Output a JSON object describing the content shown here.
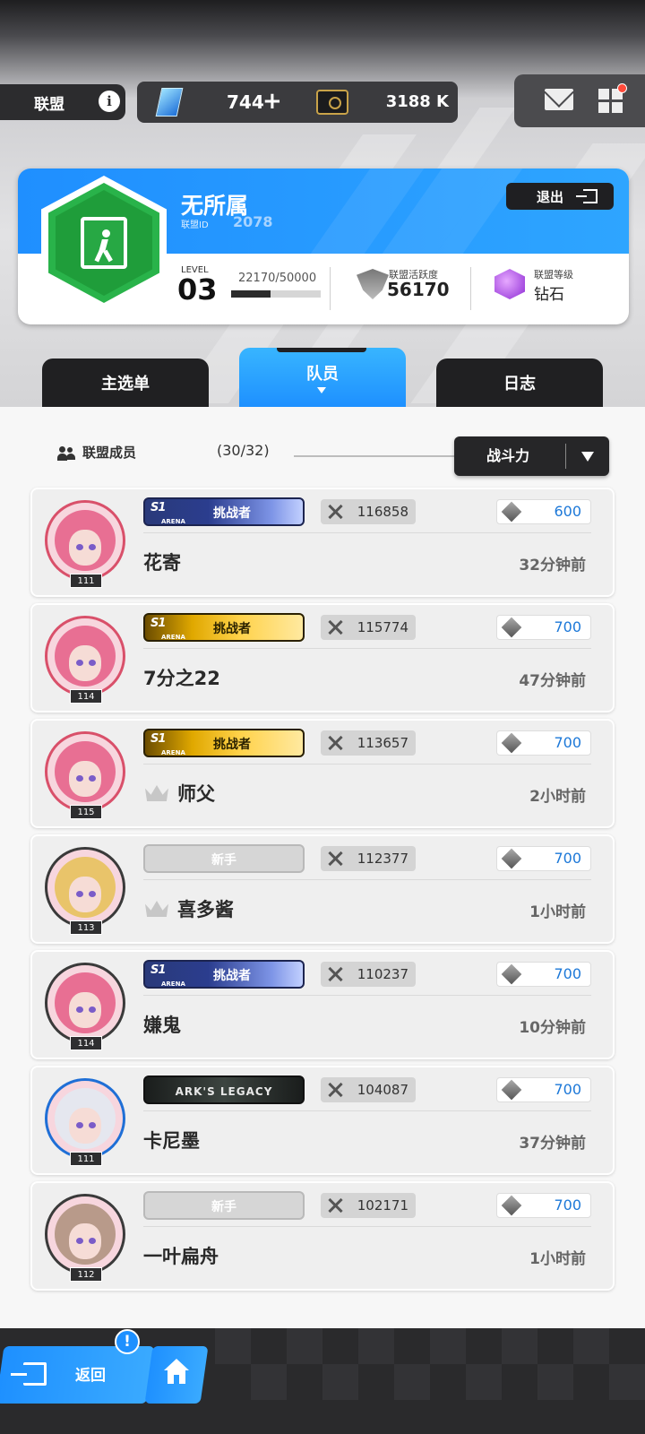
{
  "header": {
    "alliance_label": "联盟",
    "info_icon": "info-icon",
    "gems": "744",
    "plus": "+",
    "credits": "3188 K",
    "mail_icon": "mail-icon",
    "menu_icon": "grid-menu-icon"
  },
  "alliance": {
    "name": "无所属",
    "id_label": "联盟ID",
    "id": "2078",
    "exit_label": "退出",
    "level_label": "LEVEL",
    "level": "03",
    "exp": "22170/50000",
    "exp_fraction": 0.4434,
    "activity_label": "联盟活跃度",
    "activity": "56170",
    "rank_label": "联盟等级",
    "rank": "钻石"
  },
  "tabs": [
    {
      "label": "主选单"
    },
    {
      "label": "队员",
      "active": true
    },
    {
      "label": "日志"
    }
  ],
  "members_header": {
    "label": "联盟成员",
    "count": "(30/32)",
    "sort_label": "战斗力"
  },
  "members": [
    {
      "name": "花寄",
      "level": "111",
      "badge_type": "silver",
      "badge_s1": "S1",
      "badge_arena": "ARENA",
      "badge_text": "挑战者",
      "power": "116858",
      "contribution": "600",
      "time": "32分钟前",
      "crown": false
    },
    {
      "name": "7分之22",
      "level": "114",
      "badge_type": "gold",
      "badge_s1": "S1",
      "badge_arena": "ARENA",
      "badge_text": "挑战者",
      "power": "115774",
      "contribution": "700",
      "time": "47分钟前",
      "crown": false
    },
    {
      "name": "师父",
      "level": "115",
      "badge_type": "gold",
      "badge_s1": "S1",
      "badge_arena": "ARENA",
      "badge_text": "挑战者",
      "power": "113657",
      "contribution": "700",
      "time": "2小时前",
      "crown": true
    },
    {
      "name": "喜多酱",
      "level": "113",
      "badge_type": "newbie",
      "badge_text": "新手",
      "power": "112377",
      "contribution": "700",
      "time": "1小时前",
      "crown": true
    },
    {
      "name": "嫌鬼",
      "level": "114",
      "badge_type": "silver",
      "badge_s1": "S1",
      "badge_arena": "ARENA",
      "badge_text": "挑战者",
      "power": "110237",
      "contribution": "700",
      "time": "10分钟前",
      "crown": false
    },
    {
      "name": "卡尼墨",
      "level": "111",
      "badge_type": "ark",
      "badge_text": "ARK'S LEGACY",
      "power": "104087",
      "contribution": "700",
      "time": "37分钟前",
      "crown": false
    },
    {
      "name": "一叶扁舟",
      "level": "112",
      "badge_type": "newbie",
      "badge_text": "新手",
      "power": "102171",
      "contribution": "700",
      "time": "1小时前",
      "crown": false
    }
  ],
  "footer": {
    "back_label": "返回",
    "alert": "!",
    "home_icon": "home-icon"
  },
  "colors": {
    "accent": "#1e90ff",
    "dark": "#202022",
    "contribution_text": "#1c78d8"
  }
}
